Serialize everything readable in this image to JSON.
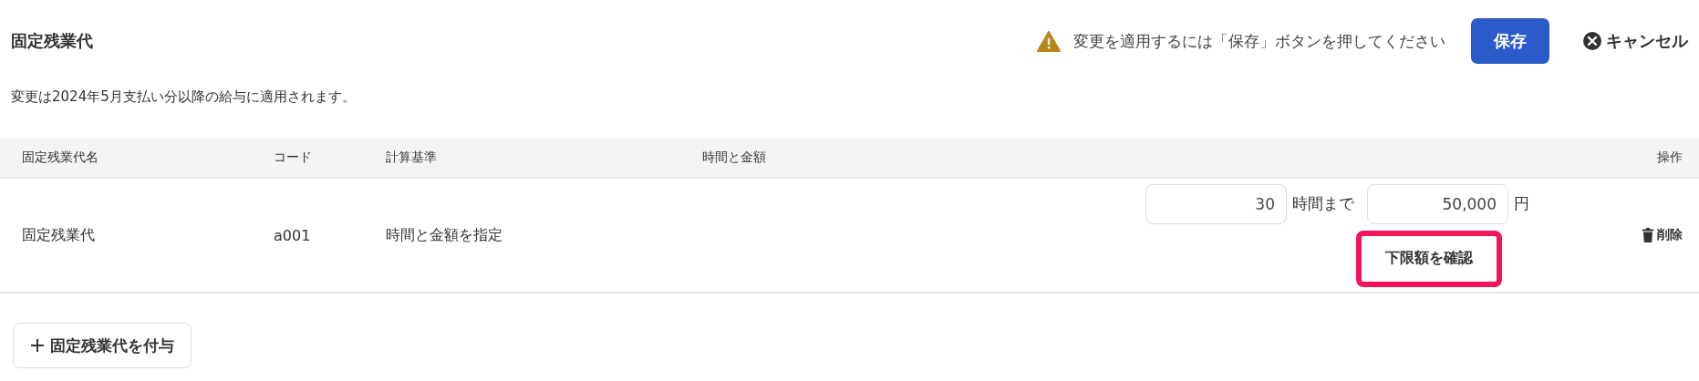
{
  "title": "固定残業代",
  "notice": {
    "text": "変更を適用するには「保存」ボタンを押してください"
  },
  "save_button": "保存",
  "cancel_button": "キャンセル",
  "description": "変更は2024年5月支払い分以降の給与に適用されます。",
  "table": {
    "columns": [
      "固定残業代名",
      "コード",
      "計算基準",
      "時間と金額",
      "操作"
    ],
    "rows": [
      {
        "name": "固定残業代",
        "code": "a001",
        "basis": "時間と金額を指定",
        "hours": "30",
        "hours_suffix": "時間まで",
        "amount": "50,000",
        "amount_suffix": "円",
        "confirm_button": {
          "label": "下限額を確認",
          "highlighted": true
        },
        "delete_button": "削除"
      }
    ]
  },
  "add_button": "固定残業代を付与"
}
